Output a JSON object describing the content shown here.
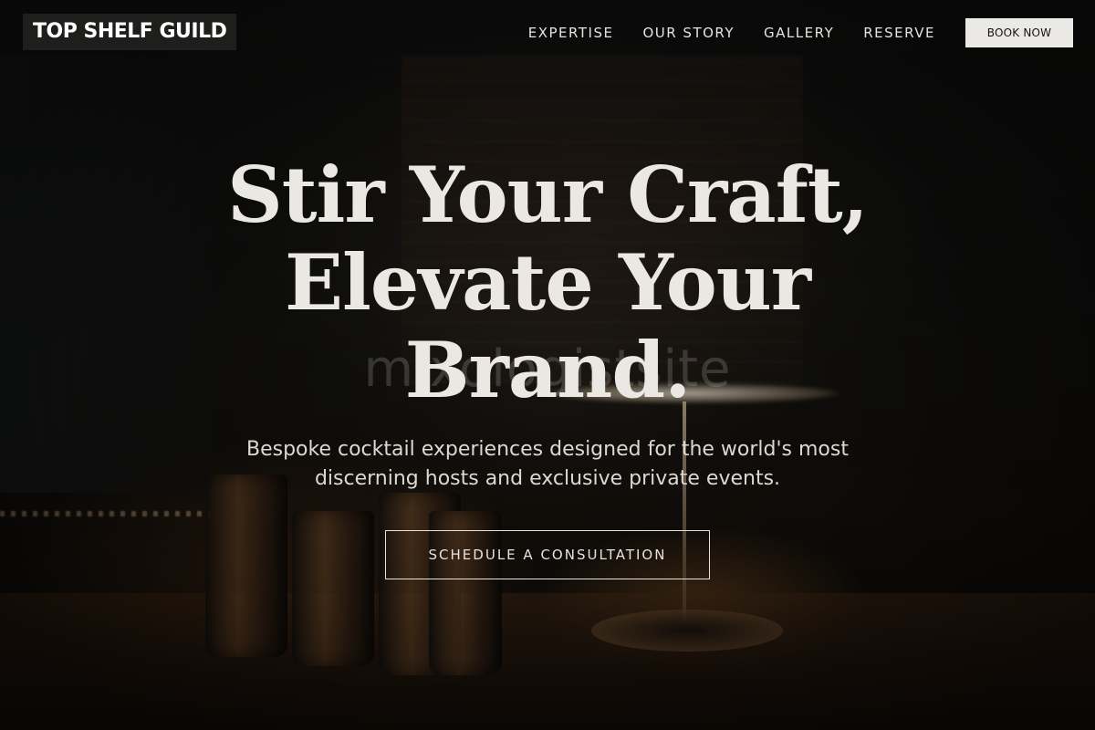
{
  "header": {
    "logo": "TOP SHELF GUILD",
    "nav": [
      {
        "label": "EXPERTISE"
      },
      {
        "label": "OUR STORY"
      },
      {
        "label": "GALLERY"
      },
      {
        "label": "RESERVE"
      }
    ],
    "book_label": "BOOK NOW"
  },
  "hero": {
    "headline_lines": [
      "Stir Your Craft,",
      "Elevate Your",
      "Brand."
    ],
    "watermark": "mixologistsite",
    "subtitle_lines": [
      "Bespoke cocktail experiences designed for the world's most",
      "discerning hosts and exclusive private events."
    ],
    "cta_label": "SCHEDULE A CONSULTATION"
  },
  "colors": {
    "text_light": "#ebe8e4",
    "button_bg": "#ebe9e6",
    "logo_bg": "#1e1e1c"
  }
}
